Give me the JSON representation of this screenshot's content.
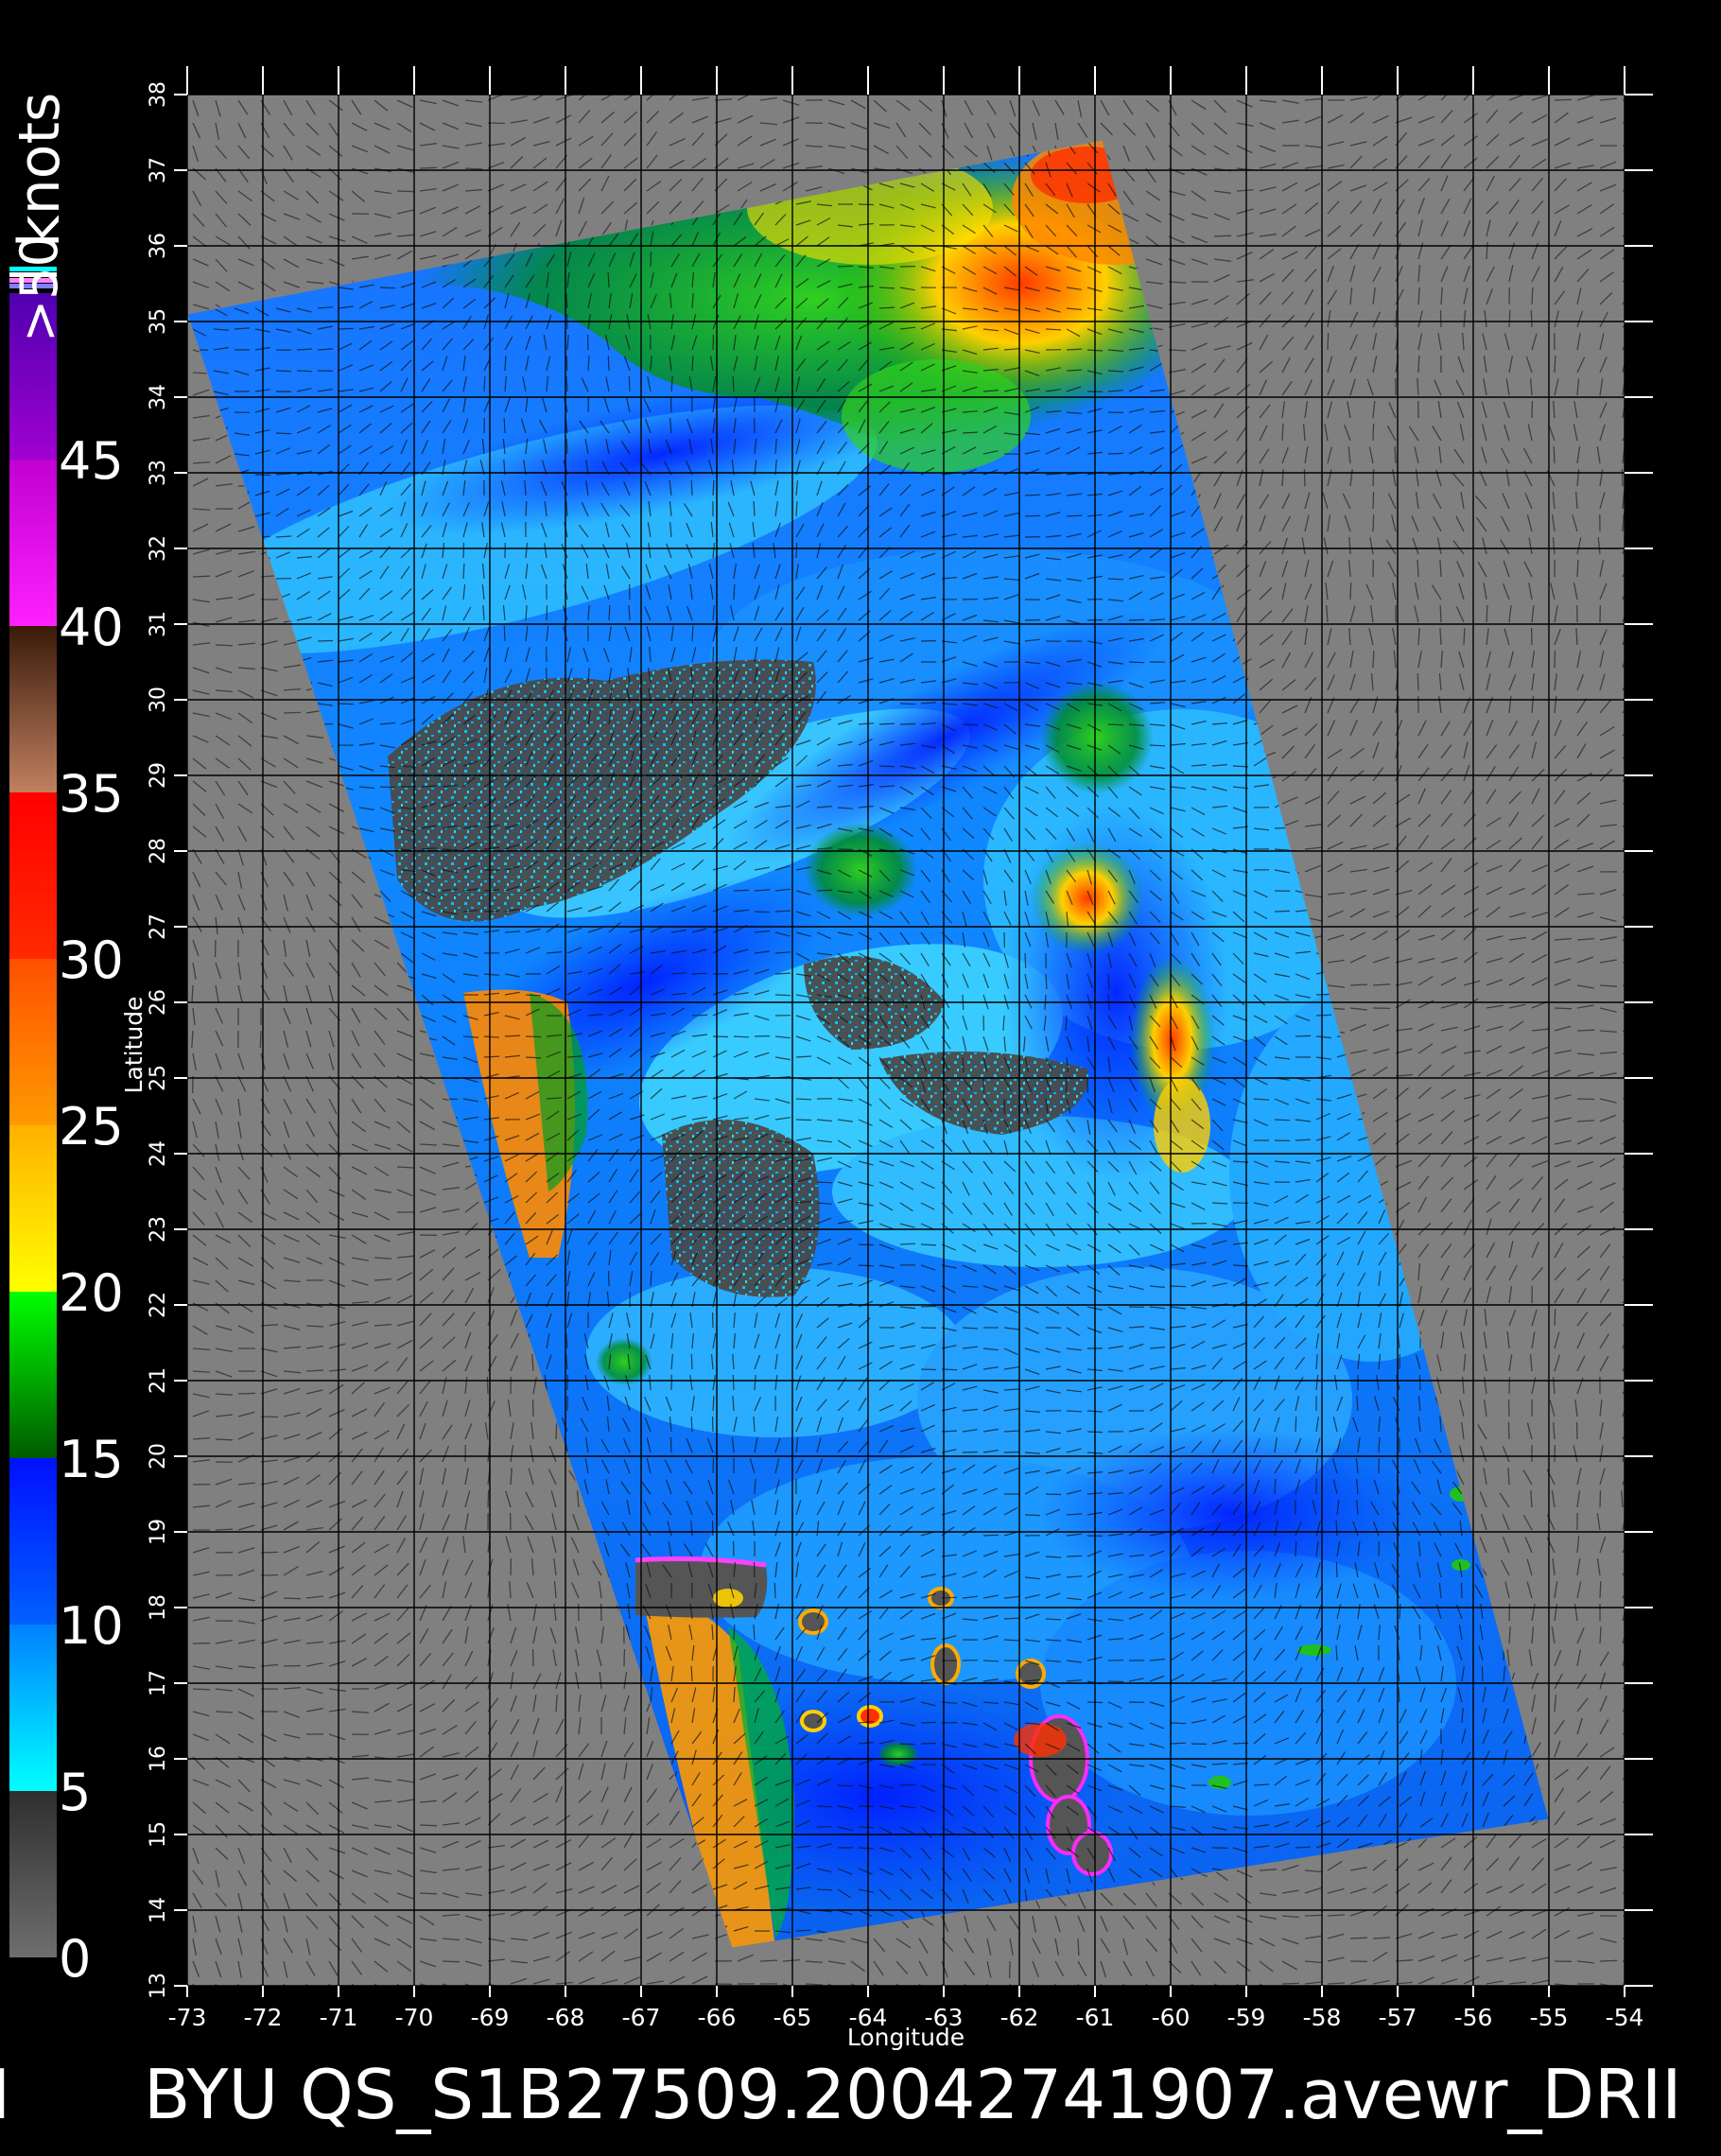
{
  "map": {
    "xlabel": "Longitude",
    "ylabel": "Latitude",
    "lon_ticks": [
      -73,
      -72,
      -71,
      -70,
      -69,
      -68,
      -67,
      -66,
      -65,
      -64,
      -63,
      -62,
      -61,
      -60,
      -59,
      -58,
      -57,
      -56,
      -55,
      -54
    ],
    "lat_ticks": [
      13,
      14,
      15,
      16,
      17,
      18,
      19,
      20,
      21,
      22,
      23,
      24,
      25,
      26,
      27,
      28,
      29,
      30,
      31,
      32,
      33,
      34,
      35,
      36,
      37,
      38
    ],
    "lon_range": [
      -73,
      -54
    ],
    "lat_range": [
      13,
      38
    ],
    "swath_corners_lonlat": [
      [
        -73.0,
        35.1
      ],
      [
        -60.9,
        37.4
      ],
      [
        -55.0,
        15.2
      ],
      [
        -65.8,
        13.5
      ]
    ],
    "background_color": "#808080",
    "land_color": "#555555"
  },
  "colorbar": {
    "units": "knots",
    "overflow_label": ">50",
    "labels": [
      "0",
      "5",
      "10",
      "15",
      "20",
      "25",
      "30",
      "35",
      "40",
      "45"
    ],
    "bands": [
      {
        "from": 0,
        "to": 5,
        "colors": [
          "#6e6e6e",
          "#2e2e2e"
        ]
      },
      {
        "from": 5,
        "to": 10,
        "colors": [
          "#00ffff",
          "#0080ff"
        ]
      },
      {
        "from": 10,
        "to": 15,
        "colors": [
          "#0060ff",
          "#0010ff"
        ]
      },
      {
        "from": 15,
        "to": 20,
        "colors": [
          "#005a00",
          "#00ff00"
        ]
      },
      {
        "from": 20,
        "to": 25,
        "colors": [
          "#ffff00",
          "#ffb000"
        ]
      },
      {
        "from": 25,
        "to": 30,
        "colors": [
          "#ff9a00",
          "#ff5000"
        ]
      },
      {
        "from": 30,
        "to": 35,
        "colors": [
          "#ff2a00",
          "#ff0000"
        ]
      },
      {
        "from": 35,
        "to": 40,
        "colors": [
          "#c08060",
          "#3a1a0a"
        ]
      },
      {
        "from": 40,
        "to": 45,
        "colors": [
          "#ff20ff",
          "#c000d0"
        ]
      },
      {
        "from": 45,
        "to": 50,
        "colors": [
          "#a000d0",
          "#5000b0"
        ]
      }
    ]
  },
  "caption": "BYU  QS_S1B27509.20042741907.avewr_DRII",
  "caption_left_fragment": "I"
}
